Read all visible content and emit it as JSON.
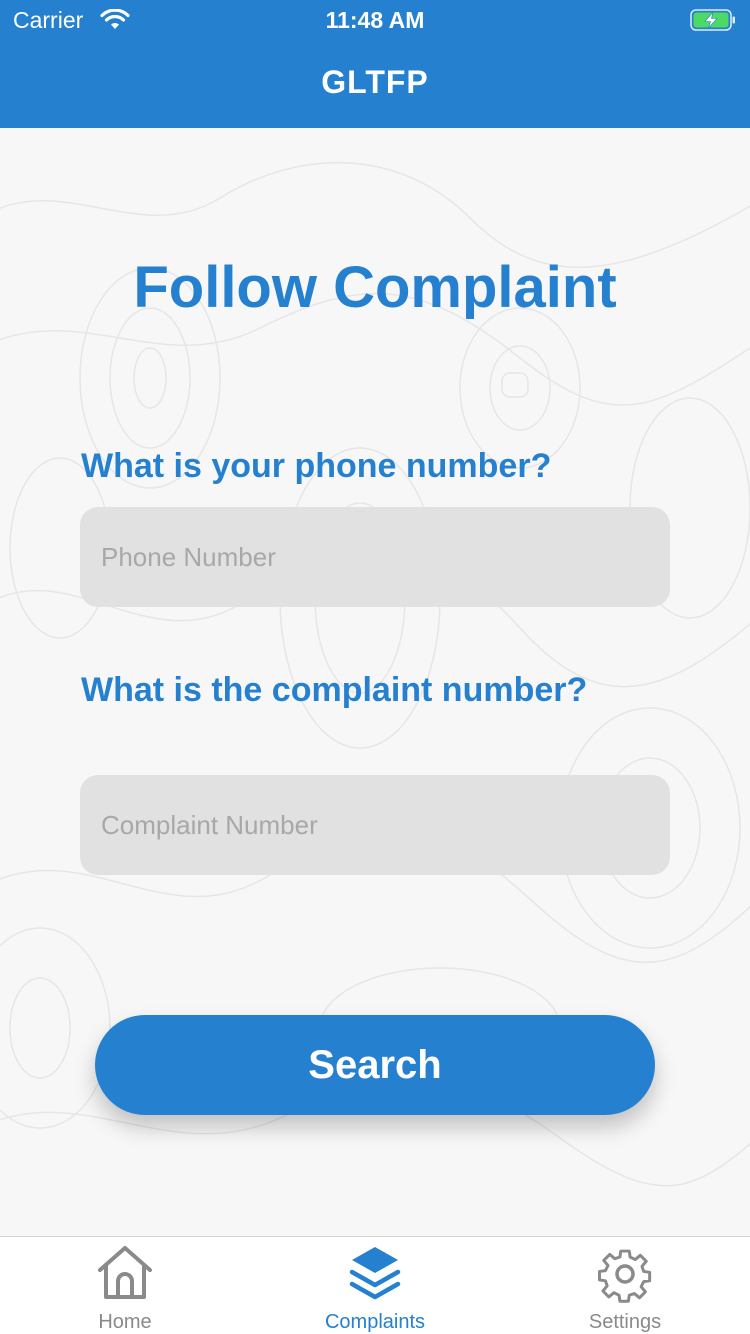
{
  "status_bar": {
    "carrier": "Carrier",
    "time": "11:48 AM"
  },
  "header": {
    "title": "GLTFP"
  },
  "page": {
    "title": "Follow Complaint",
    "phone_question": "What is your phone number?",
    "phone_placeholder": "Phone Number",
    "phone_value": "",
    "complaint_question": "What is the complaint number?",
    "complaint_placeholder": "Complaint Number",
    "complaint_value": "",
    "search_label": "Search"
  },
  "tabbar": {
    "items": [
      {
        "label": "Home",
        "icon": "home-icon",
        "active": false
      },
      {
        "label": "Complaints",
        "icon": "layers-icon",
        "active": true
      },
      {
        "label": "Settings",
        "icon": "gear-icon",
        "active": false
      }
    ]
  },
  "colors": {
    "brand": "#2580d0",
    "field_bg": "#e1e1e1",
    "placeholder": "#a8a8a8",
    "tab_inactive": "#8a8a8a",
    "battery": "#4cd964"
  }
}
